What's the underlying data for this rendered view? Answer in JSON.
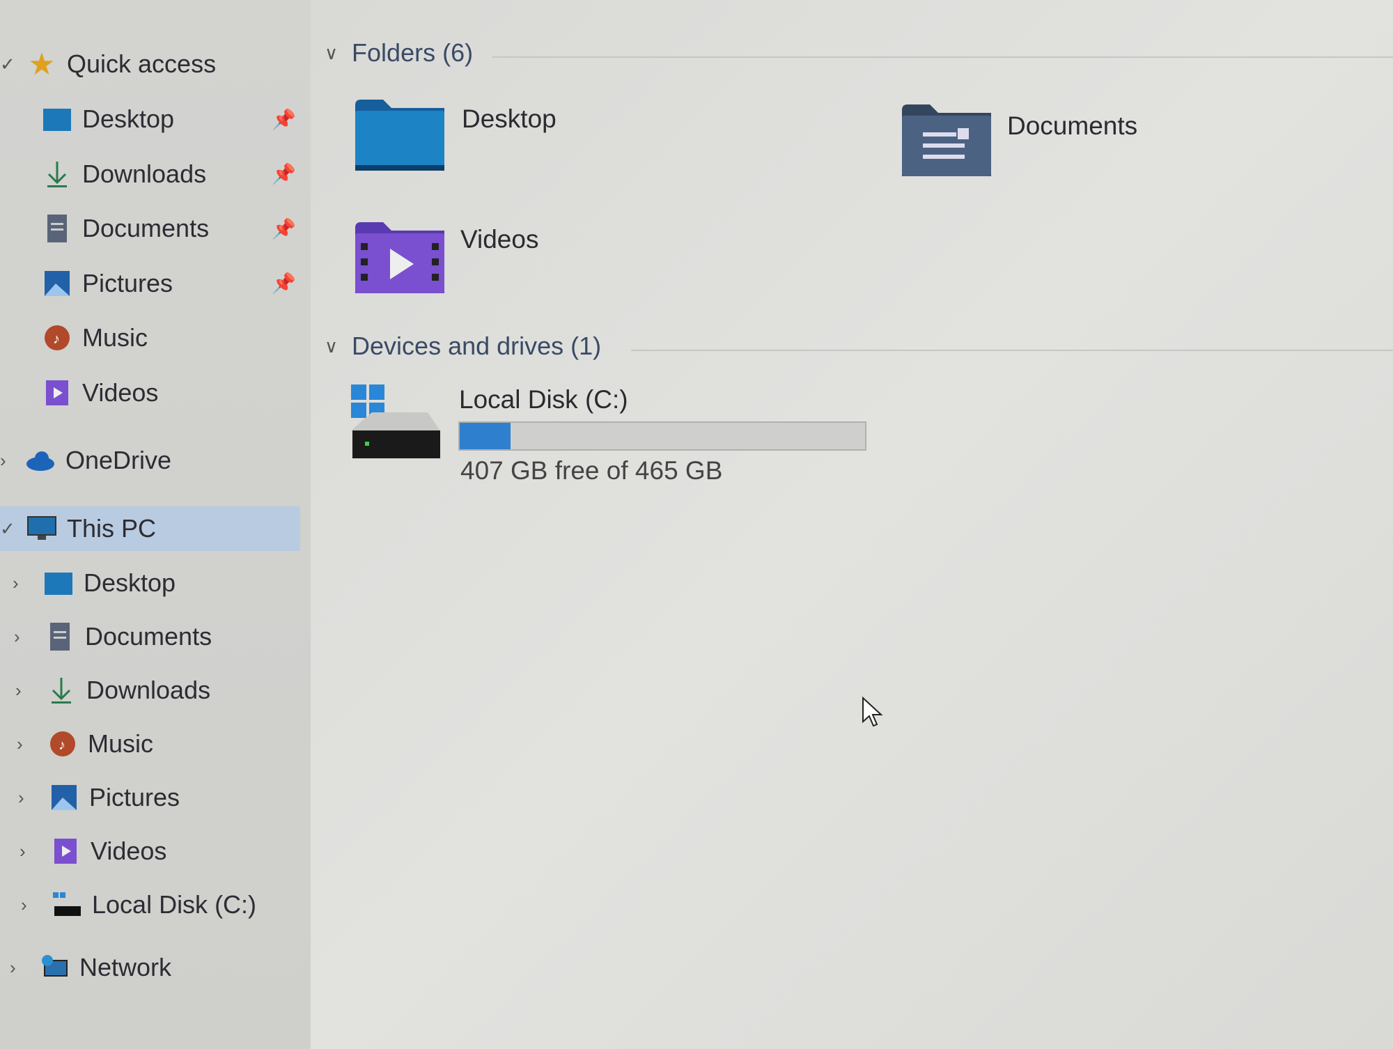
{
  "sidebar": {
    "quick_access": {
      "label": "Quick access",
      "icon": "star-icon",
      "items": [
        {
          "label": "Desktop",
          "icon": "desktop-folder-icon",
          "pinned": true
        },
        {
          "label": "Downloads",
          "icon": "download-icon",
          "pinned": true
        },
        {
          "label": "Documents",
          "icon": "documents-icon",
          "pinned": true
        },
        {
          "label": "Pictures",
          "icon": "pictures-icon",
          "pinned": true
        },
        {
          "label": "Music",
          "icon": "music-icon",
          "pinned": false
        },
        {
          "label": "Videos",
          "icon": "videos-icon",
          "pinned": false
        }
      ]
    },
    "onedrive": {
      "label": "OneDrive",
      "icon": "cloud-icon"
    },
    "this_pc": {
      "label": "This PC",
      "icon": "monitor-icon",
      "selected": true,
      "items": [
        {
          "label": "Desktop"
        },
        {
          "label": "Documents"
        },
        {
          "label": "Downloads"
        },
        {
          "label": "Music"
        },
        {
          "label": "Pictures"
        },
        {
          "label": "Videos"
        },
        {
          "label": "Local Disk (C:)"
        }
      ]
    },
    "network": {
      "label": "Network",
      "icon": "network-icon"
    }
  },
  "main": {
    "folders_header": "Folders (6)",
    "folders": [
      {
        "label": "Desktop"
      },
      {
        "label": "Documents"
      },
      {
        "label": "Videos"
      }
    ],
    "drives_header": "Devices and drives (1)",
    "drive": {
      "label": "Local Disk (C:)",
      "free_text": "407 GB free of 465 GB",
      "used_fraction": 0.125
    }
  },
  "colors": {
    "accent": "#2f7fcf",
    "selection": "#b9cbe0",
    "videos": "#7a4fd0",
    "desktop": "#1a7ab8"
  }
}
